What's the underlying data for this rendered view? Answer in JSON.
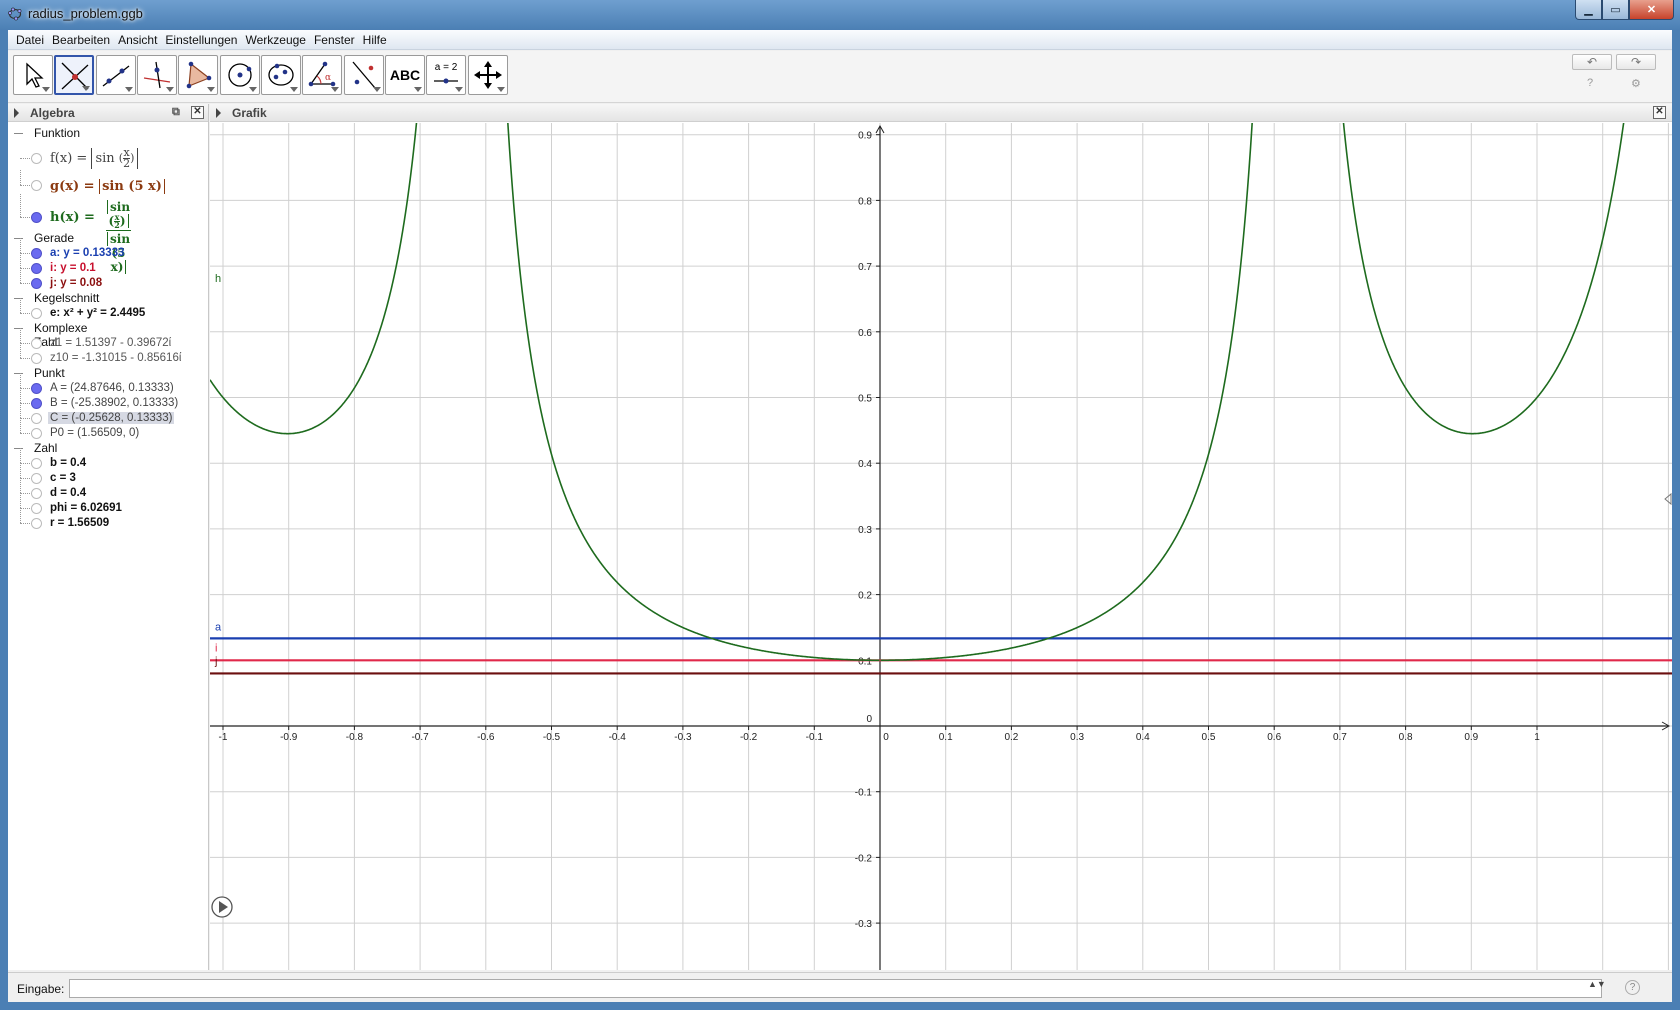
{
  "window": {
    "title": "radius_problem.ggb",
    "controls": {
      "minimize": "▁",
      "maximize": "▭",
      "close": "✕"
    }
  },
  "menu": [
    "Datei",
    "Bearbeiten",
    "Ansicht",
    "Einstellungen",
    "Werkzeuge",
    "Fenster",
    "Hilfe"
  ],
  "toolbar": {
    "tools": [
      {
        "name": "move-tool",
        "icon": "pointer-arrow-icon"
      },
      {
        "name": "point-tool",
        "icon": "point-intersect-icon",
        "active": true
      },
      {
        "name": "line-tool",
        "icon": "line-through-points-icon"
      },
      {
        "name": "perpendicular-tool",
        "icon": "perpendicular-line-icon"
      },
      {
        "name": "polygon-tool",
        "icon": "polygon-icon"
      },
      {
        "name": "circle-tool",
        "icon": "circle-center-point-icon"
      },
      {
        "name": "conic-tool",
        "icon": "ellipse-icon"
      },
      {
        "name": "angle-tool",
        "icon": "angle-icon"
      },
      {
        "name": "reflect-tool",
        "icon": "reflect-line-icon"
      },
      {
        "name": "text-tool",
        "label": "ABC"
      },
      {
        "name": "slider-tool",
        "label": "a = 2"
      },
      {
        "name": "move-view-tool",
        "icon": "move-cross-arrows-icon"
      }
    ],
    "undo_label": "↶",
    "redo_label": "↷",
    "help_label": "?",
    "settings_label": "⚙"
  },
  "algebra": {
    "title": "Algebra",
    "categories": {
      "funktion": "Funktion",
      "gerade": "Gerade",
      "kegelschnitt": "Kegelschnitt",
      "komplexe": "Komplexe Zahl",
      "punkt": "Punkt",
      "zahl": "Zahl"
    },
    "functions": {
      "f": {
        "lhs": "f(x) =",
        "text": "sin",
        "frac_num": "x",
        "frac_den": "2"
      },
      "g": {
        "lhs": "g(x) =",
        "text": "sin (5 x)"
      },
      "h": {
        "lhs": "h(x) =",
        "num_fn": "sin",
        "num_frac_num": "x",
        "num_frac_den": "2",
        "den": "sin (5 x)"
      }
    },
    "gerade": [
      {
        "text": "a: y = 0.13333",
        "color": "#1a3fb0",
        "on": true
      },
      {
        "text": "i: y = 0.1",
        "color": "#c8102e",
        "on": true
      },
      {
        "text": "j: y = 0.08",
        "color": "#8b1010",
        "on": true
      }
    ],
    "kegelschnitt": [
      {
        "text": "e: x² + y² = 2.4495",
        "color": "#111",
        "on": false
      }
    ],
    "komplexe": [
      {
        "text": "z1 = 1.51397 - 0.39672ί",
        "color": "#555",
        "on": false
      },
      {
        "text": "z10 = -1.31015 - 0.85616ί",
        "color": "#555",
        "on": false
      }
    ],
    "punkt": [
      {
        "text": "A = (24.87646, 0.13333)",
        "color": "#444",
        "on": true
      },
      {
        "text": "B = (-25.38902, 0.13333)",
        "color": "#444",
        "on": true
      },
      {
        "text": "C = (-0.25628, 0.13333)",
        "color": "#444",
        "on": false,
        "selected": true
      },
      {
        "text": "P0 = (1.56509, 0)",
        "color": "#444",
        "on": false
      }
    ],
    "zahl": [
      {
        "text": "b = 0.4",
        "color": "#111",
        "on": false
      },
      {
        "text": "c = 3",
        "color": "#111",
        "on": false
      },
      {
        "text": "d = 0.4",
        "color": "#111",
        "on": false
      },
      {
        "text": "phi = 6.02691",
        "color": "#111",
        "on": false
      },
      {
        "text": "r = 1.56509",
        "color": "#111",
        "on": false
      }
    ]
  },
  "grafik": {
    "title": "Grafik",
    "curve_label": "h",
    "line_labels": {
      "a": "a",
      "i": "i",
      "j": "j"
    },
    "colors": {
      "h": "#1e6b1e",
      "a": "#1a3fb0",
      "i": "#e0294a",
      "j": "#6b0f0f",
      "grid": "#d0d0d0"
    }
  },
  "chart_data": {
    "type": "line",
    "title": "",
    "xlabel": "",
    "ylabel": "",
    "xlim": [
      -1.1,
      1.1
    ],
    "ylim": [
      -0.3,
      0.95
    ],
    "grid": true,
    "x_ticks": [
      "-1",
      "-0.9",
      "-0.8",
      "-0.7",
      "-0.6",
      "-0.5",
      "-0.4",
      "-0.3",
      "-0.2",
      "-0.1",
      "0",
      "0.1",
      "0.2",
      "0.3",
      "0.4",
      "0.5",
      "0.6",
      "0.7",
      "0.8",
      "0.9",
      "1"
    ],
    "y_ticks": [
      "-0.3",
      "-0.2",
      "-0.1",
      "0",
      "0.1",
      "0.2",
      "0.3",
      "0.4",
      "0.5",
      "0.6",
      "0.7",
      "0.8",
      "0.9"
    ],
    "x_tick_values": [
      -1,
      -0.9,
      -0.8,
      -0.7,
      -0.6,
      -0.5,
      -0.4,
      -0.3,
      -0.2,
      -0.1,
      0,
      0.1,
      0.2,
      0.3,
      0.4,
      0.5,
      0.6,
      0.7,
      0.8,
      0.9,
      1
    ],
    "y_tick_values": [
      -0.3,
      -0.2,
      -0.1,
      0,
      0.1,
      0.2,
      0.3,
      0.4,
      0.5,
      0.6,
      0.7,
      0.8,
      0.9
    ],
    "series": [
      {
        "name": "h",
        "function": "|sin(x/2)| / |sin(5x)|"
      },
      {
        "name": "a",
        "y": 0.13333
      },
      {
        "name": "i",
        "y": 0.1
      },
      {
        "name": "j",
        "y": 0.08
      }
    ]
  },
  "inputbar": {
    "label": "Eingabe:",
    "value": "",
    "spin": "▲▼",
    "help": "?"
  }
}
